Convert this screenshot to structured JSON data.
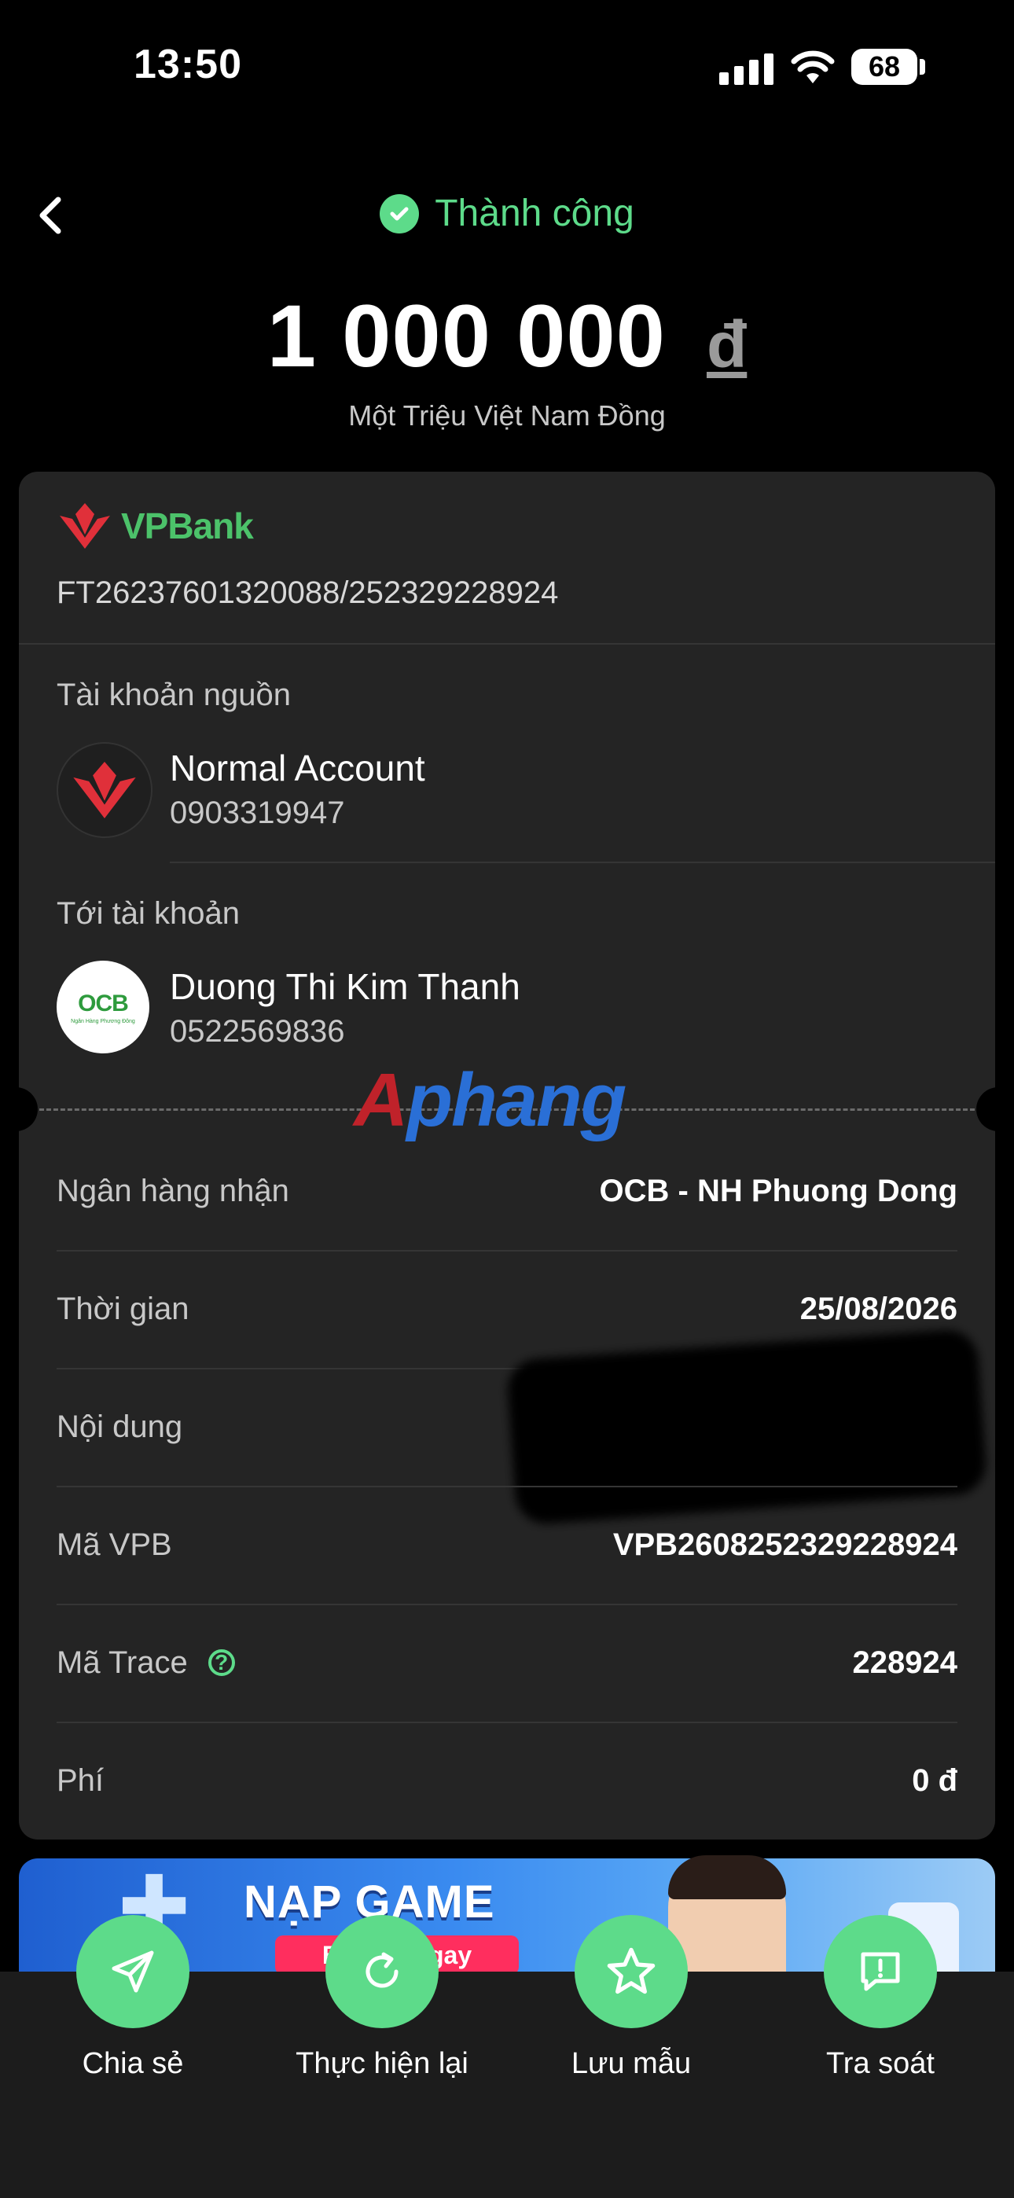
{
  "status_bar": {
    "time": "13:50",
    "battery": "68"
  },
  "header": {
    "status": "Thành công"
  },
  "amount": {
    "value": "1 000 000",
    "currency": "đ",
    "in_words": "Một Triệu Việt Nam Đồng"
  },
  "bank": {
    "name": "VPBank",
    "reference": "FT26237601320088/252329228924"
  },
  "source_account": {
    "label": "Tài khoản nguồn",
    "name": "Normal Account",
    "number": "0903319947"
  },
  "destination_account": {
    "label": "Tới tài khoản",
    "name": "Duong Thi Kim Thanh",
    "number": "0522569836",
    "bank_logo_text": "OCB",
    "bank_logo_sub": "Ngân Hàng Phương Đông"
  },
  "watermark": {
    "part1": "A",
    "part2": "phang"
  },
  "details": [
    {
      "key": "Ngân hàng nhận",
      "value": "OCB - NH Phuong Dong"
    },
    {
      "key": "Thời gian",
      "value": "25/08/2026"
    },
    {
      "key": "Nội dung",
      "value": ""
    },
    {
      "key": "Mã VPB",
      "value": "VPB2608252329228924"
    },
    {
      "key": "Mã Trace",
      "value": "228924"
    },
    {
      "key": "Phí",
      "value": "0 đ"
    }
  ],
  "banner": {
    "title": "NẠP GAME",
    "button": "Bật n... ngay"
  },
  "actions": [
    {
      "label": "Chia sẻ",
      "icon": "send-icon"
    },
    {
      "label": "Thực hiện lại",
      "icon": "refresh-icon"
    },
    {
      "label": "Lưu mẫu",
      "icon": "star-icon"
    },
    {
      "label": "Tra soát",
      "icon": "chat-icon"
    }
  ],
  "colors": {
    "accent_green": "#5ddb8a",
    "vpbank_red": "#e0303a",
    "card_bg": "#242424"
  }
}
